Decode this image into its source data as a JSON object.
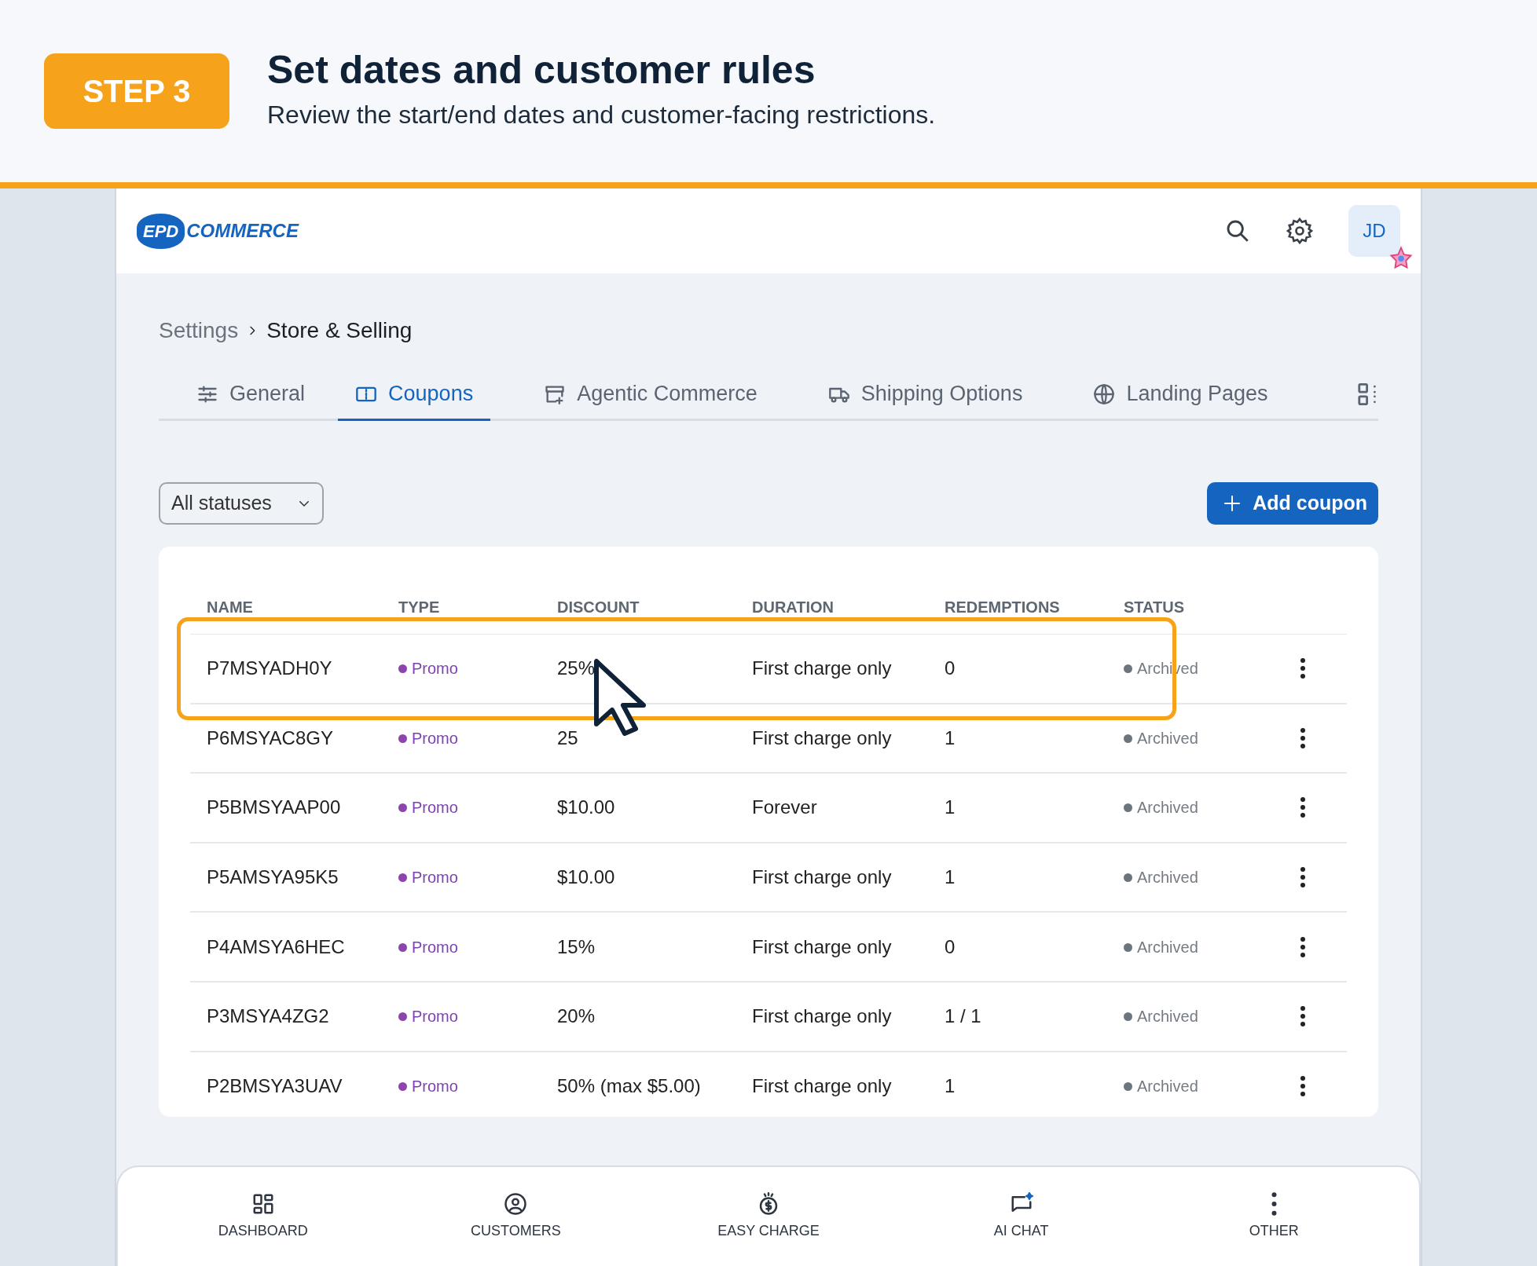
{
  "step": {
    "badge": "STEP 3",
    "title": "Set dates and customer rules",
    "subtitle": "Review the start/end dates and customer-facing restrictions."
  },
  "header": {
    "logo_mark": "EPD",
    "logo_text": "COMMERCE",
    "avatar": "JD"
  },
  "breadcrumb": [
    "Settings",
    "Store & Selling"
  ],
  "tabs": [
    {
      "label": "General",
      "selected": false
    },
    {
      "label": "Coupons",
      "selected": true
    },
    {
      "label": "Agentic Commerce",
      "selected": false
    },
    {
      "label": "Shipping Options",
      "selected": false
    },
    {
      "label": "Landing Pages",
      "selected": false
    }
  ],
  "filter": {
    "value": "All statuses"
  },
  "add_button": "Add coupon",
  "table": {
    "columns": [
      "NAME",
      "TYPE",
      "DISCOUNT",
      "DURATION",
      "REDEMPTIONS",
      "STATUS"
    ],
    "rows": [
      {
        "name": "P7MSYADH0Y",
        "type": "Promo",
        "discount": "25%",
        "duration": "First charge only",
        "redemptions": "0",
        "status": "Archived",
        "highlighted": true
      },
      {
        "name": "P6MSYAC8GY",
        "type": "Promo",
        "discount": "25",
        "duration": "First charge only",
        "redemptions": "1",
        "status": "Archived",
        "highlighted": false
      },
      {
        "name": "P5BMSYAAP00",
        "type": "Promo",
        "discount": "$10.00",
        "duration": "Forever",
        "redemptions": "1",
        "status": "Archived",
        "highlighted": false
      },
      {
        "name": "P5AMSYA95K5",
        "type": "Promo",
        "discount": "$10.00",
        "duration": "First charge only",
        "redemptions": "1",
        "status": "Archived",
        "highlighted": false
      },
      {
        "name": "P4AMSYA6HEC",
        "type": "Promo",
        "discount": "15%",
        "duration": "First charge only",
        "redemptions": "0",
        "status": "Archived",
        "highlighted": false
      },
      {
        "name": "P3MSYA4ZG2",
        "type": "Promo",
        "discount": "20%",
        "duration": "First charge only",
        "redemptions": "1 / 1",
        "status": "Archived",
        "highlighted": false
      },
      {
        "name": "P2BMSYA3UAV",
        "type": "Promo",
        "discount": "50% (max $5.00)",
        "duration": "First charge only",
        "redemptions": "1",
        "status": "Archived",
        "highlighted": false
      }
    ]
  },
  "bottom_nav": [
    {
      "label": "DASHBOARD"
    },
    {
      "label": "CUSTOMERS"
    },
    {
      "label": "EASY CHARGE"
    },
    {
      "label": "AI CHAT"
    },
    {
      "label": "OTHER"
    }
  ]
}
